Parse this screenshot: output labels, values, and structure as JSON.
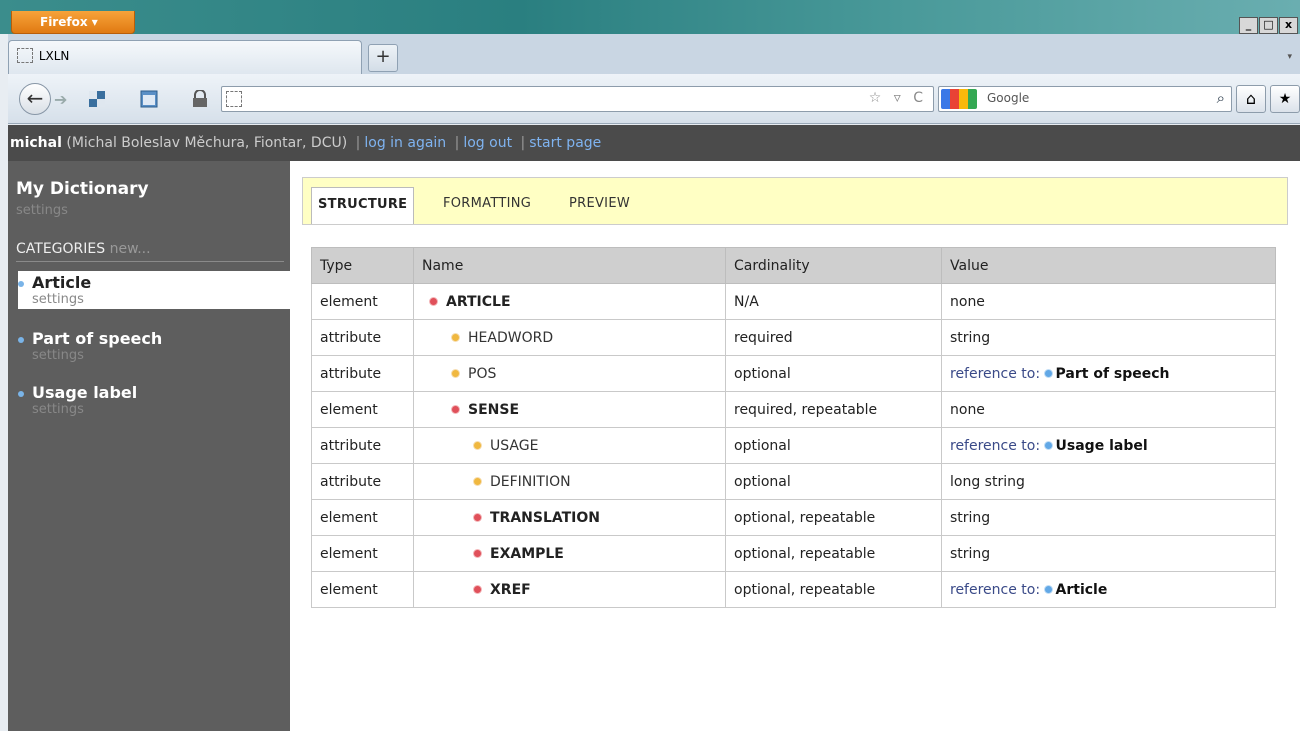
{
  "browser": {
    "menu_button": "Firefox ▾",
    "tab_title": "LXLN",
    "new_tab": "+",
    "search_placeholder": "Google",
    "window_controls": [
      "_",
      "□",
      "x"
    ],
    "url_tools": "☆ ▿ C"
  },
  "userbar": {
    "username": "michal",
    "fullname": "(Michal Boleslav Měchura, Fiontar, DCU)",
    "log_in_again": "log in again",
    "log_out": "log out",
    "start_page": "start page"
  },
  "sidebar": {
    "title": "My Dictionary",
    "settings": "settings",
    "categories_label": "CATEGORIES",
    "new_label": "new...",
    "categories": [
      {
        "name": "Article",
        "sub": "settings"
      },
      {
        "name": "Part of speech",
        "sub": "settings"
      },
      {
        "name": "Usage label",
        "sub": "settings"
      }
    ]
  },
  "tabs": {
    "structure": "STRUCTURE",
    "formatting": "FORMATTING",
    "preview": "PREVIEW"
  },
  "table": {
    "headers": [
      "Type",
      "Name",
      "Cardinality",
      "Value"
    ],
    "rows": [
      {
        "type": "element",
        "name": "ARTICLE",
        "indent": 0,
        "cardinality": "N/A",
        "value": "none"
      },
      {
        "type": "attribute",
        "name": "HEADWORD",
        "indent": 1,
        "cardinality": "required",
        "value": "string"
      },
      {
        "type": "attribute",
        "name": "POS",
        "indent": 1,
        "cardinality": "optional",
        "value_prefix": "reference to:",
        "value_ref": "Part of speech"
      },
      {
        "type": "element",
        "name": "SENSE",
        "indent": 1,
        "cardinality": "required, repeatable",
        "value": "none"
      },
      {
        "type": "attribute",
        "name": "USAGE",
        "indent": 2,
        "cardinality": "optional",
        "value_prefix": "reference to:",
        "value_ref": "Usage label"
      },
      {
        "type": "attribute",
        "name": "DEFINITION",
        "indent": 2,
        "cardinality": "optional",
        "value": "long string"
      },
      {
        "type": "element",
        "name": "TRANSLATION",
        "indent": 2,
        "cardinality": "optional, repeatable",
        "value": "string"
      },
      {
        "type": "element",
        "name": "EXAMPLE",
        "indent": 2,
        "cardinality": "optional, repeatable",
        "value": "string"
      },
      {
        "type": "element",
        "name": "XREF",
        "indent": 2,
        "cardinality": "optional, repeatable",
        "value_prefix": "reference to:",
        "value_ref": "Article"
      }
    ]
  }
}
